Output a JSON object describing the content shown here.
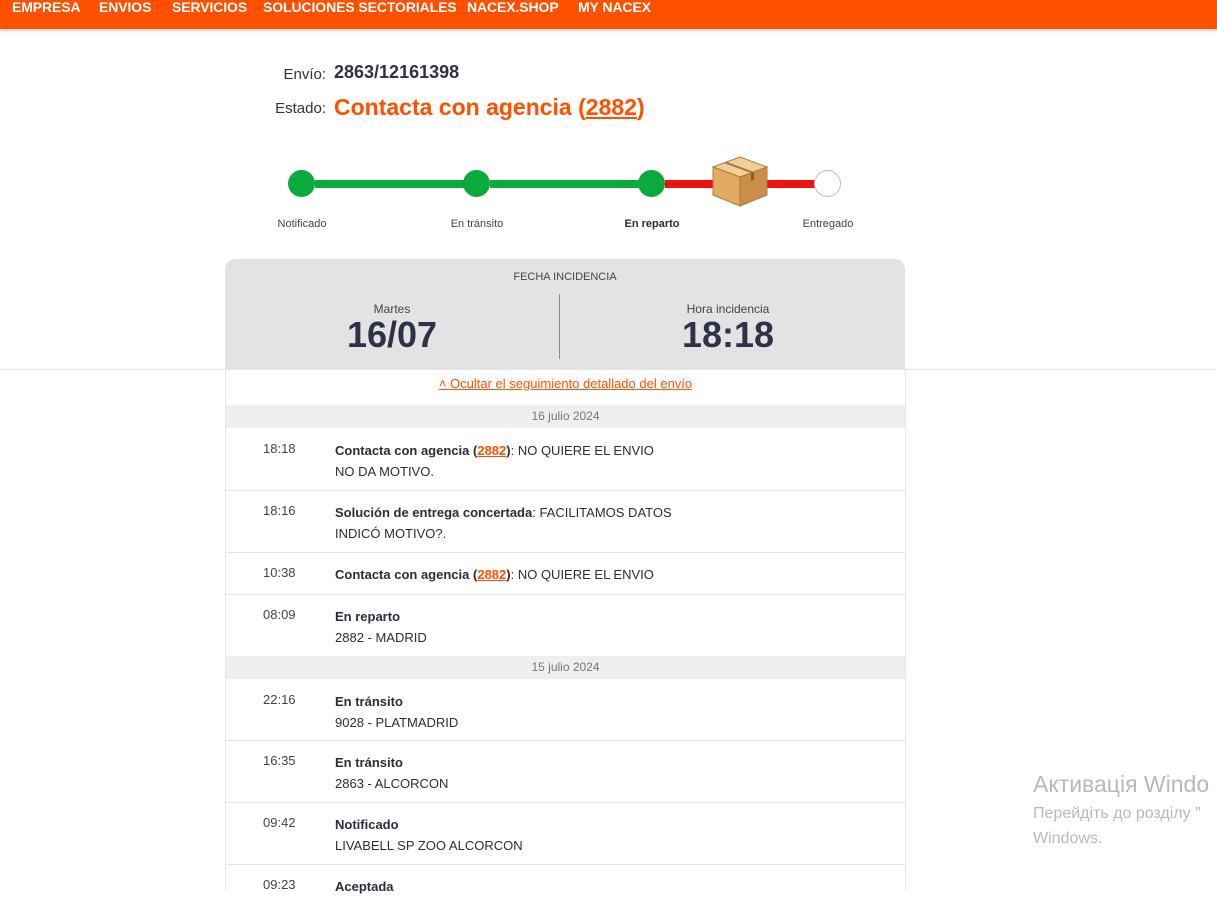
{
  "nav": {
    "items": [
      "EMPRESA",
      "ENVIOS",
      "SERVICIOS",
      "SOLUCIONES SECTORIALES",
      "NACEX.SHOP",
      "MY NACEX"
    ]
  },
  "shipment": {
    "envio_label": "Envío:",
    "envio_value": "2863/12161398",
    "estado_label": "Estado:",
    "estado_text": "Contacta con agencia (",
    "estado_link": "2882",
    "estado_close": ")"
  },
  "progress": {
    "steps": [
      "Notificado",
      "En tránsito",
      "En reparto",
      "Entregado"
    ],
    "active_step": "En reparto",
    "box_icon": "package-box-icon",
    "colors": {
      "done": "#0aaa3c",
      "incident": "#ee1111",
      "brand": "#ff5000"
    }
  },
  "incident": {
    "title": "FECHA INCIDENCIA",
    "day_label": "Martes",
    "date": "16/07",
    "hour_label": "Hora incidencia",
    "time": "18:18"
  },
  "tracking": {
    "toggle_label": "˄ Ocultar el seguimiento detallado del envío",
    "groups": [
      {
        "date": "16 julio 2024",
        "events": [
          {
            "time": "18:18",
            "title": "Contacta con agencia",
            "code": "2882",
            "line1": ": NO QUIERE EL ENVIO",
            "line2": "NO DA MOTIVO."
          },
          {
            "time": "18:16",
            "title": "Solución de entrega concertada",
            "line1": ": FACILITAMOS DATOS",
            "line2": "INDICÓ MOTIVO?."
          },
          {
            "time": "10:38",
            "title": "Contacta con agencia",
            "code": "2882",
            "line1": ": NO QUIERE EL ENVIO"
          },
          {
            "time": "08:09",
            "title": "En reparto",
            "line2": "2882 - MADRID"
          }
        ]
      },
      {
        "date": "15 julio 2024",
        "events": [
          {
            "time": "22:16",
            "title": "En tránsito",
            "line2": "9028 - PLATMADRID"
          },
          {
            "time": "16:35",
            "title": "En tránsito",
            "line2": "2863 - ALCORCON"
          },
          {
            "time": "09:42",
            "title": "Notificado",
            "line2": "LIVABELL SP ZOO ALCORCON"
          },
          {
            "time": "09:23",
            "title": "Aceptada"
          }
        ]
      }
    ]
  },
  "watermark": {
    "line1": "Активація Windo",
    "line2": "Перейдіть до розділу \"",
    "line3": "Windows."
  }
}
